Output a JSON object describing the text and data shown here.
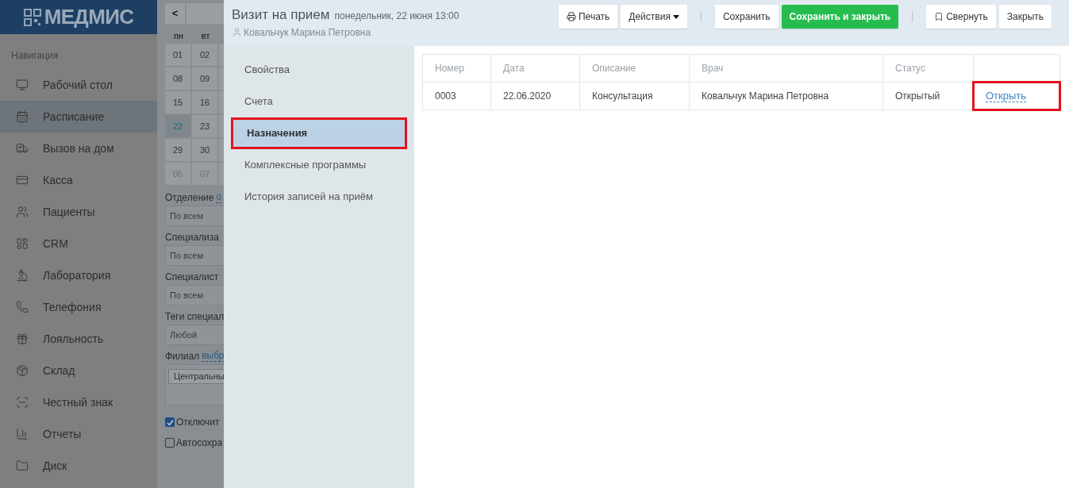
{
  "logo": {
    "text": "МЕДМИС"
  },
  "navigation": {
    "heading": "Навигация",
    "items": [
      {
        "label": "Рабочий стол",
        "selected": false
      },
      {
        "label": "Расписание",
        "selected": true
      },
      {
        "label": "Вызов на дом",
        "selected": false
      },
      {
        "label": "Касса",
        "selected": false
      },
      {
        "label": "Пациенты",
        "selected": false
      },
      {
        "label": "CRM",
        "selected": false
      },
      {
        "label": "Лаборатория",
        "selected": false
      },
      {
        "label": "Телефония",
        "selected": false
      },
      {
        "label": "Лояльность",
        "selected": false
      },
      {
        "label": "Склад",
        "selected": false
      },
      {
        "label": "Честный знак",
        "selected": false
      },
      {
        "label": "Отчеты",
        "selected": false
      },
      {
        "label": "Диск",
        "selected": false
      }
    ]
  },
  "calendar": {
    "prev": "<",
    "weekdays": [
      "пн",
      "вт"
    ],
    "days": [
      {
        "day": "01",
        "selected": false,
        "other_month": false
      },
      {
        "day": "02",
        "selected": false,
        "other_month": false
      },
      {
        "day": "08",
        "selected": false,
        "other_month": false
      },
      {
        "day": "09",
        "selected": false,
        "other_month": false
      },
      {
        "day": "15",
        "selected": false,
        "other_month": false
      },
      {
        "day": "16",
        "selected": false,
        "other_month": false
      },
      {
        "day": "22",
        "selected": true,
        "other_month": false
      },
      {
        "day": "23",
        "selected": false,
        "other_month": false
      },
      {
        "day": "29",
        "selected": false,
        "other_month": false
      },
      {
        "day": "30",
        "selected": false,
        "other_month": false
      },
      {
        "day": "06",
        "selected": false,
        "other_month": true
      },
      {
        "day": "07",
        "selected": false,
        "other_month": true
      }
    ]
  },
  "filters": [
    {
      "kind": "select",
      "label": "Отделение",
      "link": "о",
      "value": "По всем"
    },
    {
      "kind": "select",
      "label": "Специализа",
      "value": "По всем"
    },
    {
      "kind": "select",
      "label": "Специалист",
      "value": "По всем"
    },
    {
      "kind": "select",
      "label": "Теги специал",
      "value": "Любой"
    },
    {
      "kind": "tags",
      "label": "Филиал",
      "link": "выбр",
      "value": "Центральны"
    }
  ],
  "checkboxes": [
    {
      "label": "Отключит",
      "checked": true
    },
    {
      "label": "Автосохра",
      "checked": false
    }
  ],
  "drawer": {
    "title": "Визит на прием",
    "subtitle": "понедельник, 22 июня 13:00",
    "patient": "Ковальчук Марина Петровна",
    "toolbar": [
      {
        "kind": "print",
        "label": "Печать"
      },
      {
        "kind": "dropdown",
        "label": "Действия"
      },
      {
        "kind": "separator"
      },
      {
        "kind": "button",
        "label": "Сохранить"
      },
      {
        "kind": "primary",
        "label": "Сохранить и закрыть"
      },
      {
        "kind": "separator"
      },
      {
        "kind": "minimize",
        "label": "Свернуть"
      },
      {
        "kind": "button",
        "label": "Закрыть"
      }
    ],
    "menu": [
      {
        "label": "Свойства",
        "selected": false,
        "highlighted": false
      },
      {
        "label": "Счета",
        "selected": false,
        "highlighted": false
      },
      {
        "label": "Назначения",
        "selected": true,
        "highlighted": true
      },
      {
        "label": "Комплексные программы",
        "selected": false,
        "highlighted": false
      },
      {
        "label": "История записей на приём",
        "selected": false,
        "highlighted": false
      }
    ],
    "table": {
      "columns": [
        "Номер",
        "Дата",
        "Описание",
        "Врач",
        "Статус"
      ],
      "rows": [
        {
          "cells": [
            "0003",
            "22.06.2020",
            "Консультация",
            "Ковальчук Марина Петровна",
            "Открытый"
          ],
          "link": "Открыть",
          "link_highlighted": true
        }
      ]
    }
  }
}
